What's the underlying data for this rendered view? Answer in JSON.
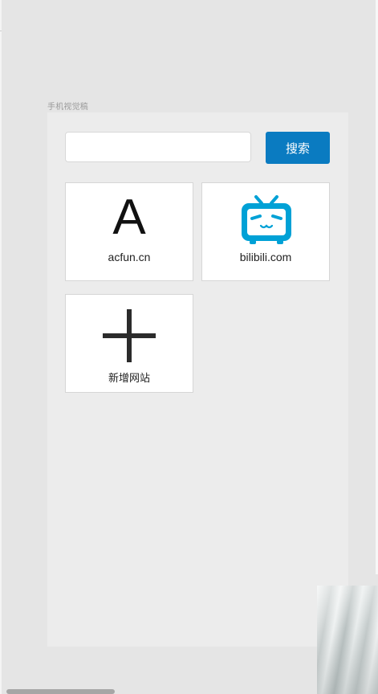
{
  "artboard": {
    "label": "手机视觉稿"
  },
  "search": {
    "value": "",
    "placeholder": "",
    "button_label": "搜索",
    "button_color": "#0a7bc1"
  },
  "sites": [
    {
      "label": "acfun.cn",
      "icon": "letter-a-icon",
      "glyph": "A"
    },
    {
      "label": "bilibili.com",
      "icon": "bilibili-tv-icon",
      "icon_color": "#00a1d6"
    },
    {
      "label": "新增网站",
      "icon": "plus-icon"
    }
  ]
}
